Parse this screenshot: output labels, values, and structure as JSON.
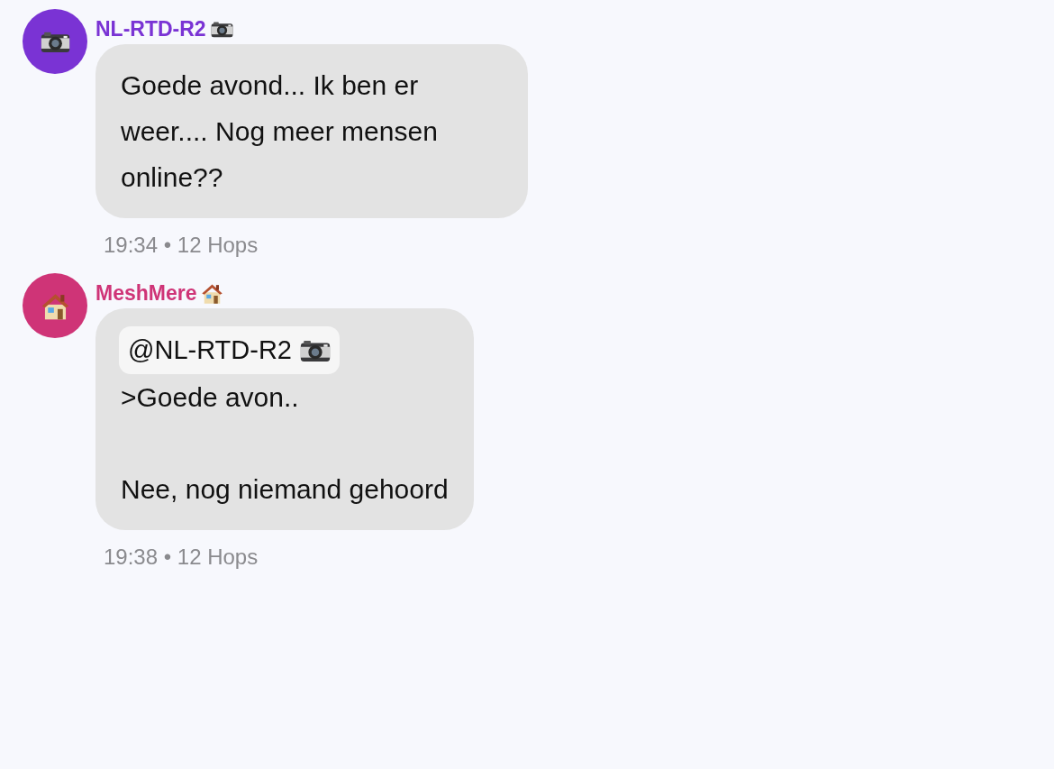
{
  "messages": [
    {
      "sender": "NL-RTD-R2",
      "avatar": {
        "kind": "camera",
        "color": "#7a33d4"
      },
      "text": "Goede avond... Ik ben er weer.... Nog meer mensen online??",
      "meta": "19:34 • 12 Hops"
    },
    {
      "sender": "MeshMere",
      "avatar": {
        "kind": "house",
        "color": "#cf3477"
      },
      "quote": {
        "mention": "@NL-RTD-R2",
        "kind": "camera"
      },
      "text": ">Goede avon..\n\nNee, nog niemand gehoord",
      "meta": "19:38 • 12 Hops"
    }
  ]
}
